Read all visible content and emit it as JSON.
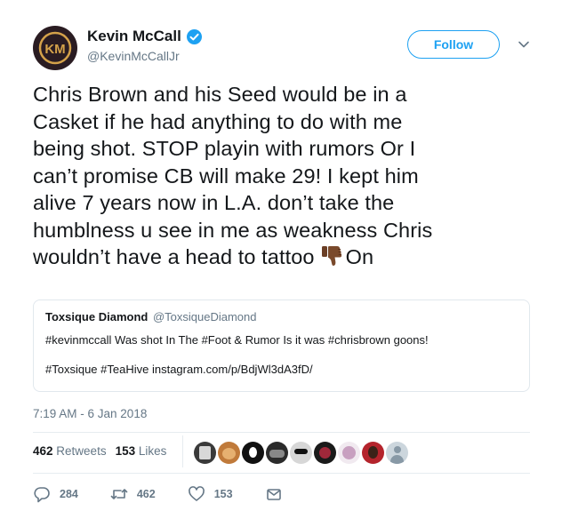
{
  "author": {
    "name": "Kevin McCall",
    "handle": "@KevinMcCallJr",
    "verified": true,
    "avatar_icon": "km-logo-avatar"
  },
  "follow_label": "Follow",
  "tweet_lines": [
    "Chris Brown and his Seed would be in a",
    "Casket if he had anything to do with me",
    "being shot. STOP playin with rumors Or I",
    "can’t promise CB will make 29! I kept him",
    "alive 7 years now in L.A. don’t take the",
    "humblness u see in me as weakness Chris",
    "wouldn’t have a head to tattoo",
    "On"
  ],
  "emoji": "thumbs-down-icon",
  "quote": {
    "name": "Toxsique Diamond",
    "handle": "@ToxsiqueDiamond",
    "line1": "#kevinmccall Was shot In The #Foot & Rumor Is it was #chrisbrown goons!",
    "line2": "#Toxsique #TeaHive instagram.com/p/BdjWl3dA3fD/"
  },
  "timestamp": "7:19 AM - 6 Jan 2018",
  "stats": {
    "retweets_count": "462",
    "retweets_label": "Retweets",
    "likes_count": "153",
    "likes_label": "Likes"
  },
  "actions": {
    "replies": "284",
    "retweets": "462",
    "likes": "153"
  },
  "colors": {
    "accent": "#1da1f2",
    "text": "#14171a",
    "muted": "#657786",
    "border": "#e1e8ed"
  }
}
